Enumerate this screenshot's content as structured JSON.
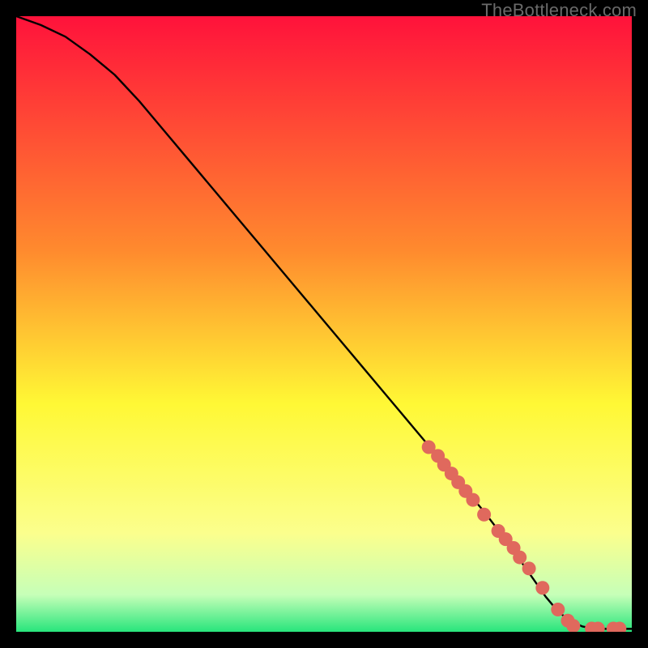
{
  "watermark": "TheBottleneck.com",
  "chart_data": {
    "type": "line",
    "title": "",
    "xlabel": "",
    "ylabel": "",
    "xlim": [
      0,
      100
    ],
    "ylim": [
      0,
      105
    ],
    "curve": {
      "name": "curve",
      "x": [
        0,
        4,
        8,
        12,
        16,
        20,
        24,
        28,
        32,
        36,
        40,
        44,
        48,
        52,
        56,
        60,
        64,
        68,
        72,
        76,
        80,
        84,
        86,
        88,
        90,
        92,
        94,
        96,
        98,
        100
      ],
      "y": [
        105,
        103.5,
        101.5,
        98.5,
        95,
        90.5,
        85.5,
        80.5,
        75.5,
        70.5,
        65.5,
        60.5,
        55.5,
        50.5,
        45.5,
        40.5,
        35.5,
        30.5,
        25.5,
        20.5,
        15.0,
        9.0,
        6.0,
        3.5,
        1.8,
        0.9,
        0.5,
        0.5,
        0.5,
        0.5
      ]
    },
    "points": {
      "name": "markers",
      "x": [
        67,
        68.5,
        69.5,
        70.7,
        71.8,
        73.0,
        74.2,
        76.0,
        78.3,
        79.5,
        80.8,
        81.8,
        83.3,
        85.5,
        88.0,
        89.6,
        90.5,
        93.5,
        94.5,
        97.0,
        98.0
      ],
      "y": [
        31.5,
        30.0,
        28.5,
        27.0,
        25.5,
        24.0,
        22.5,
        20.0,
        17.2,
        15.8,
        14.3,
        12.7,
        10.8,
        7.5,
        3.8,
        1.9,
        1.0,
        0.55,
        0.55,
        0.55,
        0.55
      ]
    },
    "colors": {
      "marker": "#e0695d",
      "line": "#000000",
      "gradient_top": "#ff123b",
      "gradient_mid1": "#ff8a2e",
      "gradient_mid2": "#fff835",
      "gradient_mid3": "#fbff8d",
      "gradient_bot1": "#c6ffb8",
      "gradient_bot2": "#28e57c"
    }
  }
}
